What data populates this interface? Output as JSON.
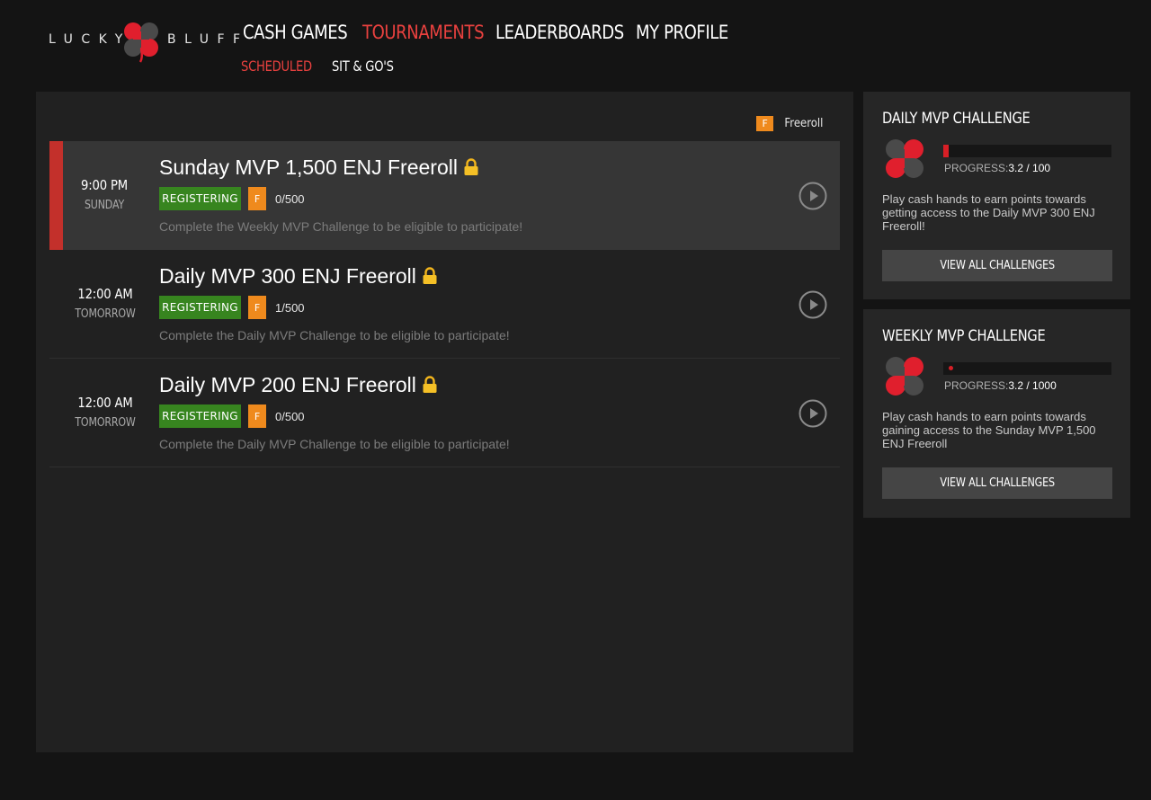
{
  "brand": {
    "left": "LUCKY",
    "right": "BLUFF"
  },
  "nav": {
    "items": [
      {
        "label": "CASH GAMES"
      },
      {
        "label": "TOURNAMENTS"
      },
      {
        "label": "LEADERBOARDS"
      },
      {
        "label": "MY PROFILE"
      }
    ],
    "active": "TOURNAMENTS",
    "sub_items": [
      {
        "label": "SCHEDULED"
      },
      {
        "label": "SIT & GO'S"
      }
    ],
    "sub_active": "SCHEDULED"
  },
  "legend": {
    "badge": "F",
    "label": "Freeroll"
  },
  "tournaments": [
    {
      "time": "9:00 PM",
      "day": "SUNDAY",
      "name": "Sunday MVP 1,500 ENJ Freeroll",
      "status": "REGISTERING",
      "type_badge": "F",
      "entrants": "0/500",
      "note": "Complete the Weekly MVP Challenge to be eligible to participate!",
      "selected": true
    },
    {
      "time": "12:00 AM",
      "day": "TOMORROW",
      "name": "Daily MVP 300 ENJ Freeroll",
      "status": "REGISTERING",
      "type_badge": "F",
      "entrants": "1/500",
      "note": "Complete the Daily MVP Challenge to be eligible to participate!",
      "selected": false
    },
    {
      "time": "12:00 AM",
      "day": "TOMORROW",
      "name": "Daily MVP 200 ENJ Freeroll",
      "status": "REGISTERING",
      "type_badge": "F",
      "entrants": "0/500",
      "note": "Complete the Daily MVP Challenge to be eligible to participate!",
      "selected": false
    }
  ],
  "challenges": [
    {
      "title": "DAILY MVP CHALLENGE",
      "progress_label": "PROGRESS:",
      "progress_value": "3.2 / 100",
      "progress_fraction": 0.032,
      "description": "Play cash hands to earn points towards getting access to the Daily MVP 300 ENJ Freeroll!",
      "button": "VIEW ALL CHALLENGES"
    },
    {
      "title": "WEEKLY MVP CHALLENGE",
      "progress_label": "PROGRESS:",
      "progress_value": "3.2 / 1000",
      "progress_fraction": 0.0032,
      "description": "Play cash hands to earn points towards gaining access to the Sunday MVP 1,500 ENJ Freeroll",
      "button": "VIEW ALL CHALLENGES"
    }
  ],
  "colors": {
    "accent_red": "#e9413f",
    "freeroll_orange": "#ef8a1d",
    "registering_green": "#37851f",
    "selected_stripe": "#c3302b"
  },
  "icons": {
    "lock": "lock-icon",
    "play": "play-circle-icon",
    "brand": "clover-logo-icon"
  }
}
